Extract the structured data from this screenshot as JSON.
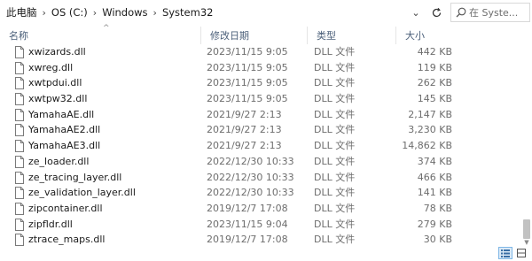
{
  "address": {
    "crumbs": [
      "此电脑",
      "OS (C:)",
      "Windows",
      "System32"
    ],
    "search_placeholder": "在 Syste..."
  },
  "columns": {
    "name": "名称",
    "date": "修改日期",
    "type": "类型",
    "size": "大小"
  },
  "files": [
    {
      "name": "xwizards.dll",
      "date": "2023/11/15 9:05",
      "type": "DLL 文件",
      "size": "442 KB"
    },
    {
      "name": "xwreg.dll",
      "date": "2023/11/15 9:05",
      "type": "DLL 文件",
      "size": "119 KB"
    },
    {
      "name": "xwtpdui.dll",
      "date": "2023/11/15 9:05",
      "type": "DLL 文件",
      "size": "262 KB"
    },
    {
      "name": "xwtpw32.dll",
      "date": "2023/11/15 9:05",
      "type": "DLL 文件",
      "size": "145 KB"
    },
    {
      "name": "YamahaAE.dll",
      "date": "2021/9/27 2:13",
      "type": "DLL 文件",
      "size": "2,147 KB"
    },
    {
      "name": "YamahaAE2.dll",
      "date": "2021/9/27 2:13",
      "type": "DLL 文件",
      "size": "3,230 KB"
    },
    {
      "name": "YamahaAE3.dll",
      "date": "2021/9/27 2:13",
      "type": "DLL 文件",
      "size": "14,862 KB"
    },
    {
      "name": "ze_loader.dll",
      "date": "2022/12/30 10:33",
      "type": "DLL 文件",
      "size": "374 KB"
    },
    {
      "name": "ze_tracing_layer.dll",
      "date": "2022/12/30 10:33",
      "type": "DLL 文件",
      "size": "466 KB"
    },
    {
      "name": "ze_validation_layer.dll",
      "date": "2022/12/30 10:33",
      "type": "DLL 文件",
      "size": "141 KB"
    },
    {
      "name": "zipcontainer.dll",
      "date": "2019/12/7 17:08",
      "type": "DLL 文件",
      "size": "78 KB"
    },
    {
      "name": "zipfldr.dll",
      "date": "2023/11/15 9:04",
      "type": "DLL 文件",
      "size": "279 KB"
    },
    {
      "name": "ztrace_maps.dll",
      "date": "2019/12/7 17:08",
      "type": "DLL 文件",
      "size": "30 KB"
    }
  ],
  "icons": {
    "file": "dll-file-icon",
    "refresh": "refresh-icon",
    "search": "search-icon",
    "dropdown": "chevron-down-icon"
  },
  "colors": {
    "header_text": "#4c607a",
    "meta_text": "#6d6d6d",
    "accent": "#7fb7e6"
  }
}
